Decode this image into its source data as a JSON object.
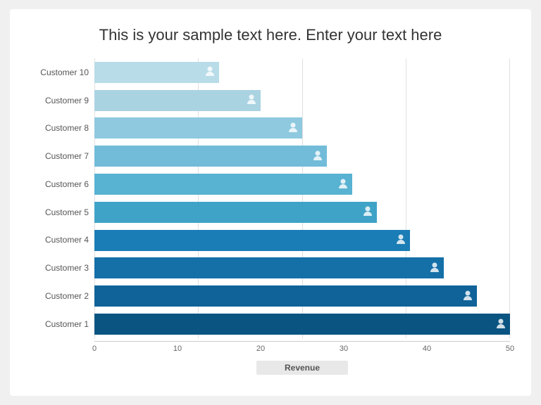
{
  "title": "This is your sample text here. Enter your text here",
  "chart": {
    "xAxisLabel": "Revenue",
    "xTicks": [
      "0",
      "10",
      "20",
      "30",
      "40",
      "50"
    ],
    "maxValue": 50,
    "bars": [
      {
        "label": "Customer 10",
        "value": 15,
        "color": "#b8dce8"
      },
      {
        "label": "Customer 9",
        "value": 20,
        "color": "#aad3e2"
      },
      {
        "label": "Customer 8",
        "value": 25,
        "color": "#8ec9df"
      },
      {
        "label": "Customer 7",
        "value": 28,
        "color": "#72bcd9"
      },
      {
        "label": "Customer 6",
        "value": 31,
        "color": "#58b2d2"
      },
      {
        "label": "Customer 5",
        "value": 34,
        "color": "#3fa3c8"
      },
      {
        "label": "Customer 4",
        "value": 38,
        "color": "#1a7db5"
      },
      {
        "label": "Customer 3",
        "value": 42,
        "color": "#1570a8"
      },
      {
        "label": "Customer 2",
        "value": 46,
        "color": "#0f6398"
      },
      {
        "label": "Customer 1",
        "value": 50,
        "color": "#0a5482"
      }
    ]
  },
  "icon": "👤"
}
